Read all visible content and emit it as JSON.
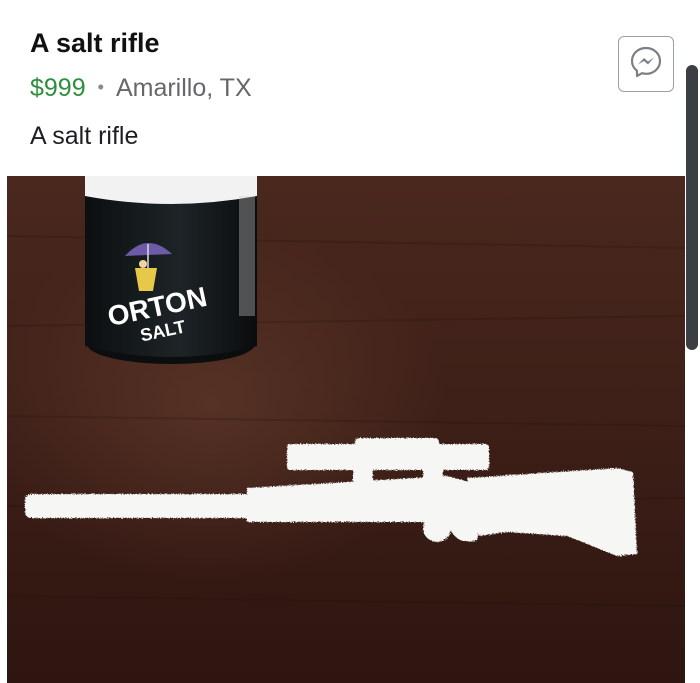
{
  "listing": {
    "title": "A salt rifle",
    "price": "$999",
    "separator": "•",
    "location": "Amarillo, TX",
    "description": "A salt rifle",
    "price_color": "#2e8f3e"
  },
  "actions": {
    "messenger_icon": "messenger-icon"
  },
  "photo": {
    "canister_brand": "ORTON",
    "canister_product": "SALT",
    "table_color": "#3e1f17"
  }
}
